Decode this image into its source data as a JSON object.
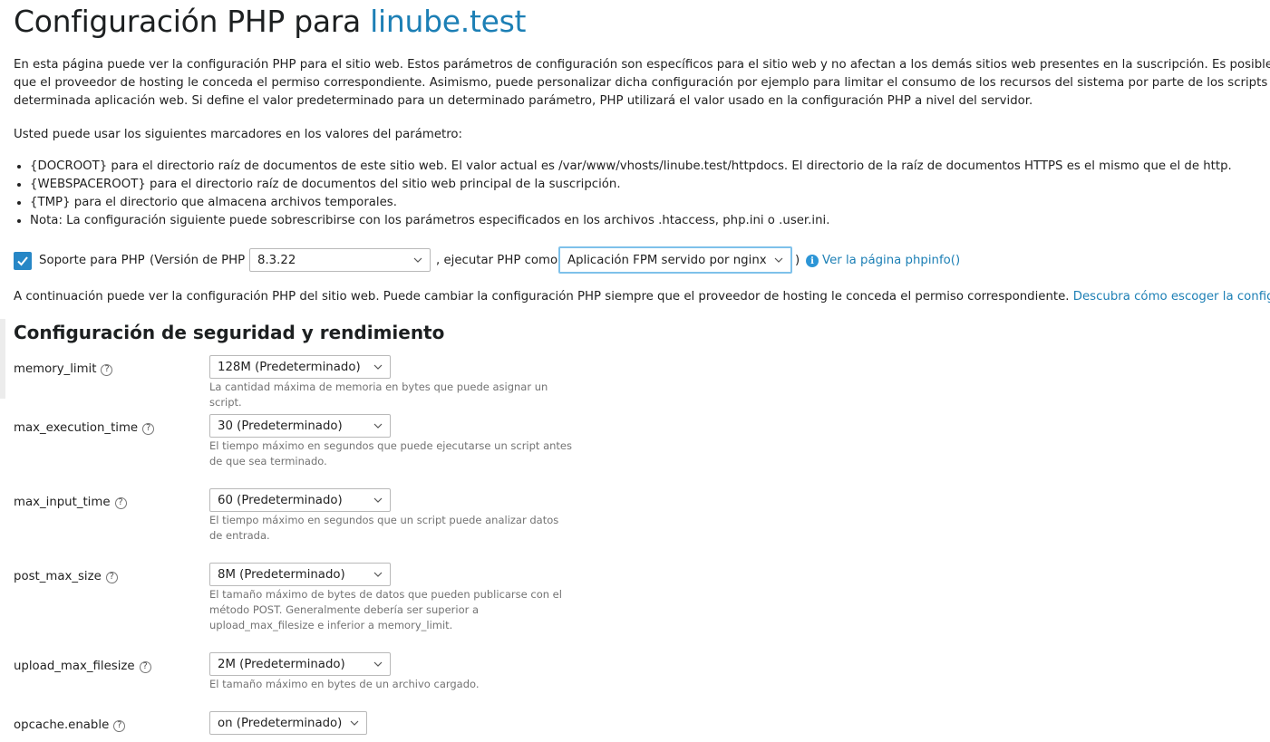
{
  "title": {
    "prefix": "Configuración PHP para",
    "site": "linube.test"
  },
  "intro": {
    "line1": "En esta página puede ver la configuración PHP para el sitio web. Estos parámetros de configuración son específicos para el sitio web y no afectan a los demás sitios web presentes en la suscripción. Es posible modif",
    "line2": "que el proveedor de hosting le conceda el permiso correspondiente. Asimismo, puede personalizar dicha configuración por ejemplo para limitar el consumo de los recursos del sistema por parte de los scripts PHP",
    "line3": "determinada aplicación web. Si define el valor predeterminado para un determinado parámetro, PHP utilizará el valor usado en la configuración PHP a nivel del servidor."
  },
  "markers_intro": "Usted puede usar los siguientes marcadores en los valores del parámetro:",
  "markers": [
    "{DOCROOT} para el directorio raíz de documentos de este sitio web. El valor actual es /var/www/vhosts/linube.test/httpdocs. El directorio de la raíz de documentos HTTPS es el mismo que el de http.",
    "{WEBSPACEROOT} para el directorio raíz de documentos del sitio web principal de la suscripción.",
    "{TMP} para el directorio que almacena archivos temporales.",
    "Nota: La configuración siguiente puede sobrescribirse con los parámetros especificados en los archivos .htaccess, php.ini o .user.ini."
  ],
  "php_support": {
    "checked": true,
    "label": "Soporte para PHP",
    "version_prefix": "(Versión de PHP",
    "version": "8.3.22",
    "run_as_label": ", ejecutar PHP como",
    "handler": "Aplicación FPM servido por nginx",
    "close_paren": ")",
    "phpinfo_link": "Ver la página phpinfo()"
  },
  "continue_text": "A continuación puede ver la configuración PHP del sitio web. Puede cambiar la configuración PHP siempre que el proveedor de hosting le conceda el permiso correspondiente.",
  "continue_link": "Descubra cómo escoger la configurac",
  "section_title": "Configuración de seguridad y rendimiento",
  "settings": [
    {
      "name": "memory_limit",
      "value": "128M (Predeterminado)",
      "desc": "La cantidad máxima de memoria en bytes que puede asignar un script."
    },
    {
      "name": "max_execution_time",
      "value": "30 (Predeterminado)",
      "desc": "El tiempo máximo en segundos que puede ejecutarse un script antes de que sea terminado."
    },
    {
      "name": "max_input_time",
      "value": "60 (Predeterminado)",
      "desc": "El tiempo máximo en segundos que un script puede analizar datos de entrada."
    },
    {
      "name": "post_max_size",
      "value": "8M (Predeterminado)",
      "desc": "El tamaño máximo de bytes de datos que pueden publicarse con el método POST. Generalmente debería ser superior a upload_max_filesize e inferior a memory_limit."
    },
    {
      "name": "upload_max_filesize",
      "value": "2M (Predeterminado)",
      "desc": "El tamaño máximo en bytes de un archivo cargado."
    },
    {
      "name": "opcache.enable",
      "value": "on (Predeterminado)",
      "desc": ""
    }
  ],
  "colors": {
    "link": "#1c7fb5",
    "checkbox": "#2787c6",
    "focus": "#7ec1ea",
    "muted": "#737373"
  },
  "help_icon_glyph": "?",
  "info_icon_glyph": "i"
}
